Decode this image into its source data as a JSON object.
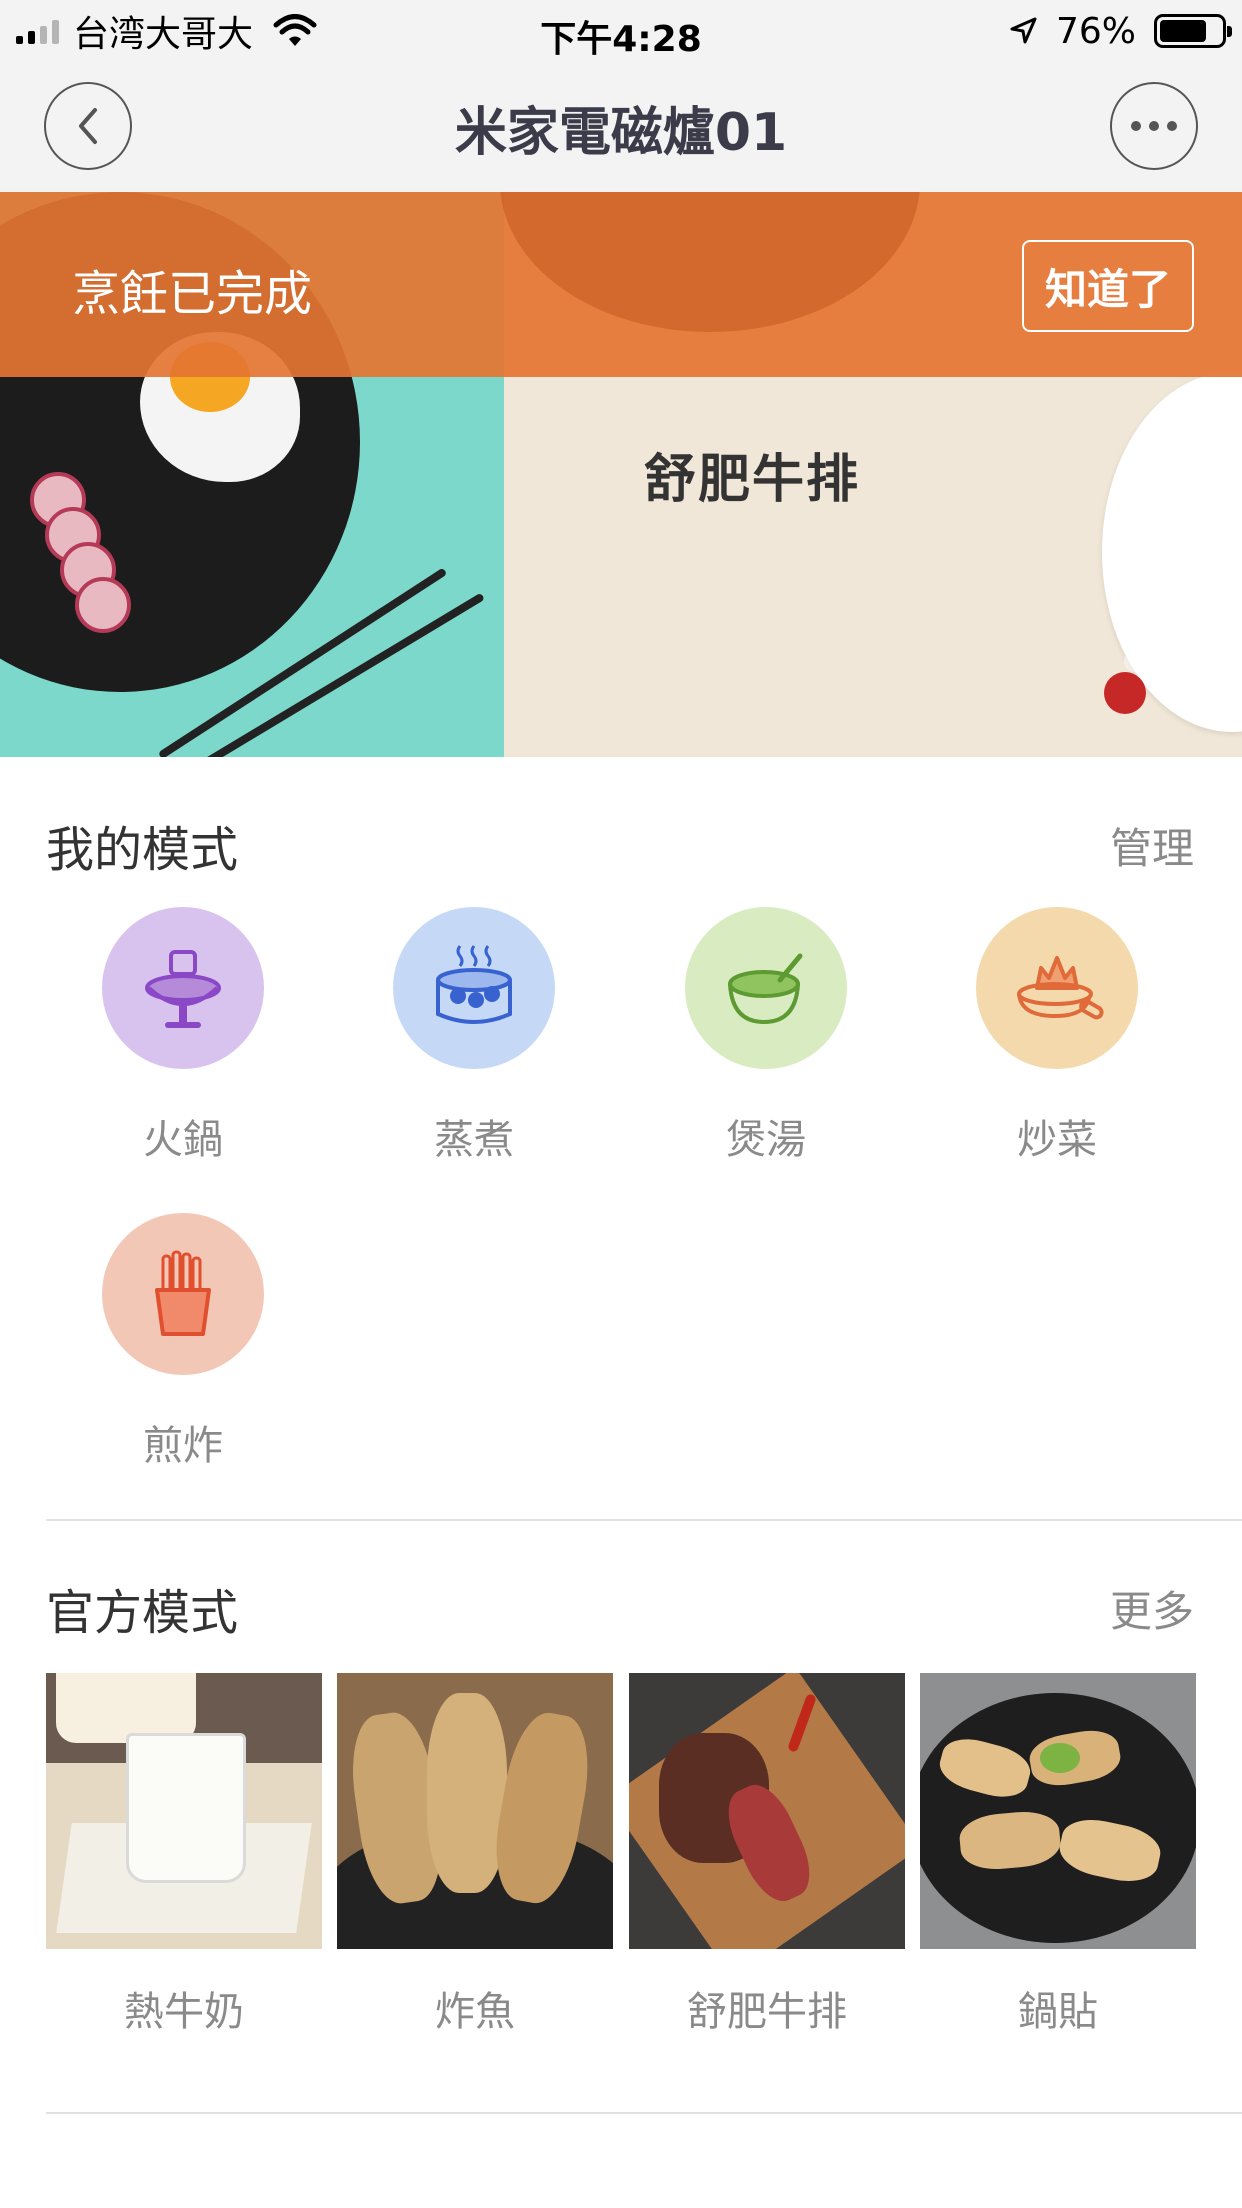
{
  "status_bar": {
    "carrier": "台湾大哥大",
    "time": "下午4:28",
    "battery_percent": "76%",
    "battery_level": 0.76,
    "icons": [
      "signal-icon",
      "wifi-icon",
      "location-arrow-icon",
      "battery-icon"
    ]
  },
  "nav": {
    "title": "米家電磁爐01",
    "back_icon": "chevron-left-icon",
    "more_icon": "more-dots-icon"
  },
  "banner": {
    "notice_text": "烹飪已完成",
    "notice_button": "知道了",
    "slide_title": "舒肥牛排",
    "page_count": 2,
    "active_page": 2
  },
  "my_modes": {
    "title": "我的模式",
    "action": "管理",
    "items": [
      {
        "label": "火鍋",
        "icon": "hotpot-icon",
        "bg": "#d8c3ee",
        "fg": "#8a48c6"
      },
      {
        "label": "蒸煮",
        "icon": "steamer-icon",
        "bg": "#c5d8f6",
        "fg": "#3762d0"
      },
      {
        "label": "煲湯",
        "icon": "soup-bowl-icon",
        "bg": "#d9ecc1",
        "fg": "#5d9a31"
      },
      {
        "label": "炒菜",
        "icon": "frying-pan-icon",
        "bg": "#f4d9ad",
        "fg": "#e06a3a"
      },
      {
        "label": "煎炸",
        "icon": "fries-icon",
        "bg": "#f3c7b6",
        "fg": "#e0502f"
      }
    ]
  },
  "official_modes": {
    "title": "官方模式",
    "action": "更多",
    "items": [
      {
        "label": "熱牛奶",
        "image": "milk-photo"
      },
      {
        "label": "炸魚",
        "image": "fried-fish-photo"
      },
      {
        "label": "舒肥牛排",
        "image": "steak-photo"
      },
      {
        "label": "鍋貼",
        "image": "potstickers-photo"
      }
    ]
  },
  "colors": {
    "notice_orange": "#e47532",
    "banner_teal": "#7cd8cb",
    "banner_cream": "#f1e7d8",
    "text_gray": "#8a8a8a"
  }
}
